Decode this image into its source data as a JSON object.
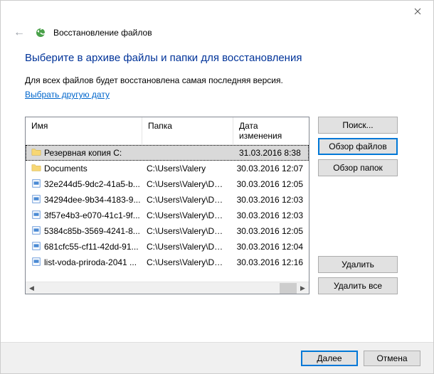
{
  "window": {
    "title": "Восстановление файлов"
  },
  "page": {
    "heading": "Выберите в архиве файлы и папки для восстановления",
    "description": "Для всех файлов будет восстановлена самая последняя версия.",
    "change_date_link": "Выбрать другую дату"
  },
  "table": {
    "headers": {
      "name": "Имя",
      "folder": "Папка",
      "modified": "Дата изменения"
    },
    "rows": [
      {
        "icon": "folder",
        "name": "Резервная копия C:",
        "folder": "",
        "date": "31.03.2016 8:38",
        "selected": true
      },
      {
        "icon": "folder",
        "name": "Documents",
        "folder": "C:\\Users\\Valery",
        "date": "30.03.2016 12:07",
        "selected": false
      },
      {
        "icon": "file",
        "name": "32e244d5-9dc2-41a5-b...",
        "folder": "C:\\Users\\Valery\\Docu...",
        "date": "30.03.2016 12:05",
        "selected": false
      },
      {
        "icon": "file",
        "name": "34294dee-9b34-4183-9...",
        "folder": "C:\\Users\\Valery\\Docu...",
        "date": "30.03.2016 12:03",
        "selected": false
      },
      {
        "icon": "file",
        "name": "3f57e4b3-e070-41c1-9f...",
        "folder": "C:\\Users\\Valery\\Docu...",
        "date": "30.03.2016 12:03",
        "selected": false
      },
      {
        "icon": "file",
        "name": "5384c85b-3569-4241-8...",
        "folder": "C:\\Users\\Valery\\Docu...",
        "date": "30.03.2016 12:05",
        "selected": false
      },
      {
        "icon": "file",
        "name": "681cfc55-cf11-42dd-91...",
        "folder": "C:\\Users\\Valery\\Docu...",
        "date": "30.03.2016 12:04",
        "selected": false
      },
      {
        "icon": "file",
        "name": "list-voda-priroda-2041 ...",
        "folder": "C:\\Users\\Valery\\Docu...",
        "date": "30.03.2016 12:16",
        "selected": false
      }
    ]
  },
  "buttons": {
    "search": "Поиск...",
    "browse_files": "Обзор файлов",
    "browse_folders": "Обзор папок",
    "delete": "Удалить",
    "delete_all": "Удалить все",
    "next": "Далее",
    "cancel": "Отмена"
  }
}
